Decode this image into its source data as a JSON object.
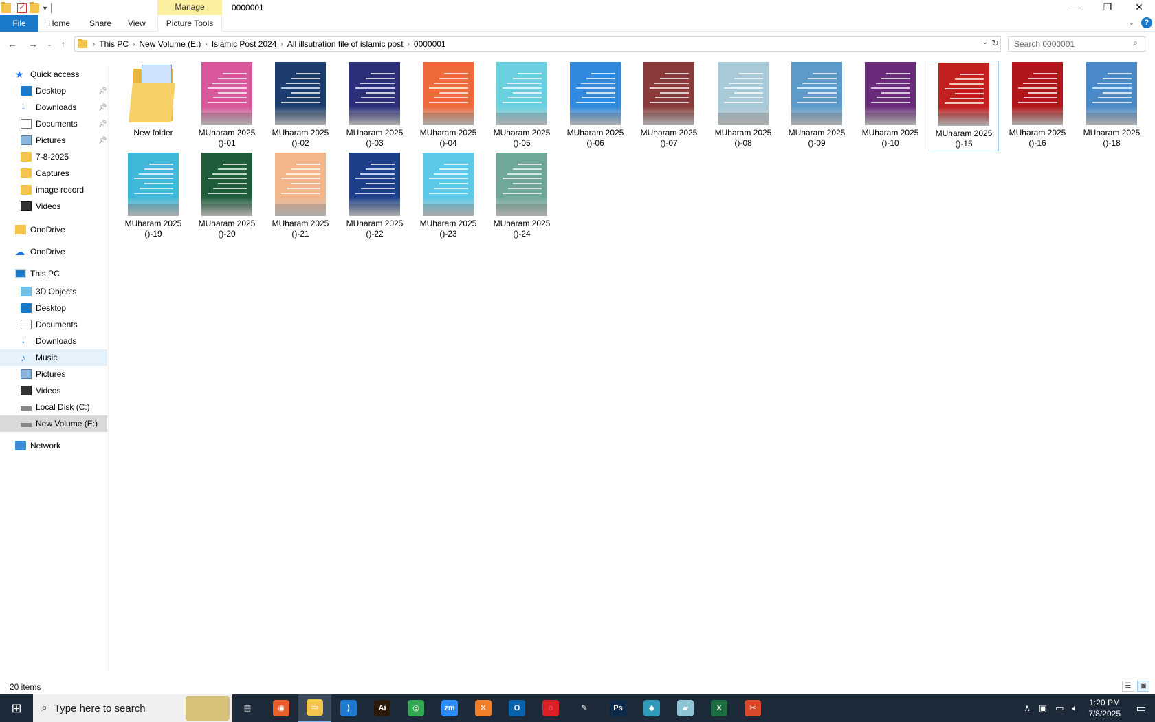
{
  "window": {
    "title": "0000001",
    "manage_tab": "Manage",
    "controls": [
      "—",
      "❐",
      "✕"
    ]
  },
  "ribbon": {
    "tabs": [
      "File",
      "Home",
      "Share",
      "View",
      "Picture Tools"
    ]
  },
  "address": {
    "crumbs": [
      "This PC",
      "New Volume (E:)",
      "Islamic Post 2024",
      "All illsutration file of islamic post",
      "0000001"
    ],
    "search_placeholder": "Search 0000001"
  },
  "nav": {
    "items": [
      {
        "label": "Quick access",
        "icon": "star-icon"
      },
      {
        "label": "Desktop",
        "icon": "desktop-icon",
        "pinned": true
      },
      {
        "label": "Downloads",
        "icon": "download-icon",
        "pinned": true
      },
      {
        "label": "Documents",
        "icon": "documents-icon",
        "pinned": true
      },
      {
        "label": "Pictures",
        "icon": "pictures-icon",
        "pinned": true
      },
      {
        "label": "7-8-2025",
        "icon": "folder-icon"
      },
      {
        "label": "Captures",
        "icon": "folder-icon"
      },
      {
        "label": "image record",
        "icon": "folder-icon"
      },
      {
        "label": "Videos",
        "icon": "videos-icon"
      },
      {
        "label": "OneDrive",
        "icon": "folder-icon"
      },
      {
        "label": "OneDrive",
        "icon": "cloud-icon"
      },
      {
        "label": "This PC",
        "icon": "pc-icon"
      },
      {
        "label": "3D Objects",
        "icon": "3d-objects-icon"
      },
      {
        "label": "Desktop",
        "icon": "desktop-icon"
      },
      {
        "label": "Documents",
        "icon": "documents-icon"
      },
      {
        "label": "Downloads",
        "icon": "download-icon"
      },
      {
        "label": "Music",
        "icon": "music-icon"
      },
      {
        "label": "Pictures",
        "icon": "pictures-icon"
      },
      {
        "label": "Videos",
        "icon": "videos-icon"
      },
      {
        "label": "Local Disk (C:)",
        "icon": "disk-icon"
      },
      {
        "label": "New Volume (E:)",
        "icon": "disk-icon"
      },
      {
        "label": "Network",
        "icon": "network-icon"
      }
    ]
  },
  "files": [
    {
      "label": "New folder",
      "type": "folder"
    },
    {
      "label": "MUharam 2025 ()-01",
      "color": "#d9579a"
    },
    {
      "label": "MUharam 2025 ()-02",
      "color": "#1d3d6e"
    },
    {
      "label": "MUharam 2025 ()-03",
      "color": "#2b2f7a"
    },
    {
      "label": "MUharam 2025 ()-04",
      "color": "#ee6a3a"
    },
    {
      "label": "MUharam 2025 ()-05",
      "color": "#6ad0e0"
    },
    {
      "label": "MUharam 2025 ()-06",
      "color": "#2f8ae0"
    },
    {
      "label": "MUharam 2025 ()-07",
      "color": "#8a3a3a"
    },
    {
      "label": "MUharam 2025 ()-08",
      "color": "#a8c9d8"
    },
    {
      "label": "MUharam 2025 ()-09",
      "color": "#5b9ac9"
    },
    {
      "label": "MUharam 2025 ()-10",
      "color": "#6a2b7a"
    },
    {
      "label": "MUharam 2025 ()-15",
      "color": "#c21f1f"
    },
    {
      "label": "MUharam 2025 ()-16",
      "color": "#b0161a"
    },
    {
      "label": "MUharam 2025 ()-18",
      "color": "#4a8ac9"
    },
    {
      "label": "MUharam 2025 ()-19",
      "color": "#3fb8d9"
    },
    {
      "label": "MUharam 2025 ()-20",
      "color": "#1f5c3a"
    },
    {
      "label": "MUharam 2025 ()-21",
      "color": "#f3b68a"
    },
    {
      "label": "MUharam 2025 ()-22",
      "color": "#1d3f8a"
    },
    {
      "label": "MUharam 2025 ()-23",
      "color": "#5cc9e8"
    },
    {
      "label": "MUharam 2025 ()-24",
      "color": "#6fa89a"
    }
  ],
  "status": {
    "count": "20 items"
  },
  "taskbar": {
    "search_placeholder": "Type here to search",
    "apps": [
      {
        "name": "task-view",
        "glyph": "▤",
        "color": "#1c2a3a"
      },
      {
        "name": "firefox",
        "glyph": "◉",
        "color": "#e8602c"
      },
      {
        "name": "file-explorer",
        "glyph": "▭",
        "color": "#f3c54d"
      },
      {
        "name": "vscode",
        "glyph": "⟩",
        "color": "#1f7ad1"
      },
      {
        "name": "illustrator",
        "glyph": "Ai",
        "color": "#2b1a0a"
      },
      {
        "name": "chrome",
        "glyph": "◎",
        "color": "#34a853"
      },
      {
        "name": "zoom",
        "glyph": "zm",
        "color": "#2d8cff"
      },
      {
        "name": "xampp",
        "glyph": "✕",
        "color": "#f07f2c"
      },
      {
        "name": "outlook",
        "glyph": "O",
        "color": "#0a64ad"
      },
      {
        "name": "creative-cloud",
        "glyph": "◌",
        "color": "#da1f26"
      },
      {
        "name": "pen-tool",
        "glyph": "✎",
        "color": "#1c2a3a"
      },
      {
        "name": "photoshop",
        "glyph": "Ps",
        "color": "#0b2a4a"
      },
      {
        "name": "app-diamond",
        "glyph": "◆",
        "color": "#2f9bb8"
      },
      {
        "name": "app-paper",
        "glyph": "▰",
        "color": "#8fc3d6"
      },
      {
        "name": "excel",
        "glyph": "X",
        "color": "#1d6f42"
      },
      {
        "name": "snip-tool",
        "glyph": "✂",
        "color": "#d94a2c"
      }
    ],
    "time": "1:20 PM",
    "date": "7/8/2025"
  }
}
